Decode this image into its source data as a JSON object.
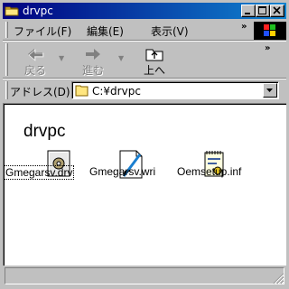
{
  "window": {
    "title": "drvpc",
    "title_icon": "folder-icon",
    "controls": [
      "minimize-icon",
      "maximize-icon",
      "close-icon"
    ]
  },
  "menubar": {
    "items": [
      "ファイル(F)",
      "編集(E)",
      "表示(V)"
    ],
    "overflow": "»"
  },
  "toolbar": {
    "back_label": "戻る",
    "forward_label": "進む",
    "up_label": "上へ",
    "overflow": "»"
  },
  "address": {
    "label": "アドレス(D)",
    "value": "C:¥drvpc"
  },
  "content": {
    "folder_title": "drvpc",
    "files": [
      {
        "name": "Gmegarsv.drv",
        "icon": "driver-file-icon",
        "selected": true
      },
      {
        "name": "Gmegarsv.wri",
        "icon": "write-document-icon",
        "selected": false
      },
      {
        "name": "Oemsetup.inf",
        "icon": "setup-info-icon",
        "selected": false
      }
    ]
  },
  "colors": {
    "titlebar_start": "#000080",
    "titlebar_end": "#1084d0",
    "face": "#c0c0c0",
    "content_bg": "#ffffff"
  }
}
